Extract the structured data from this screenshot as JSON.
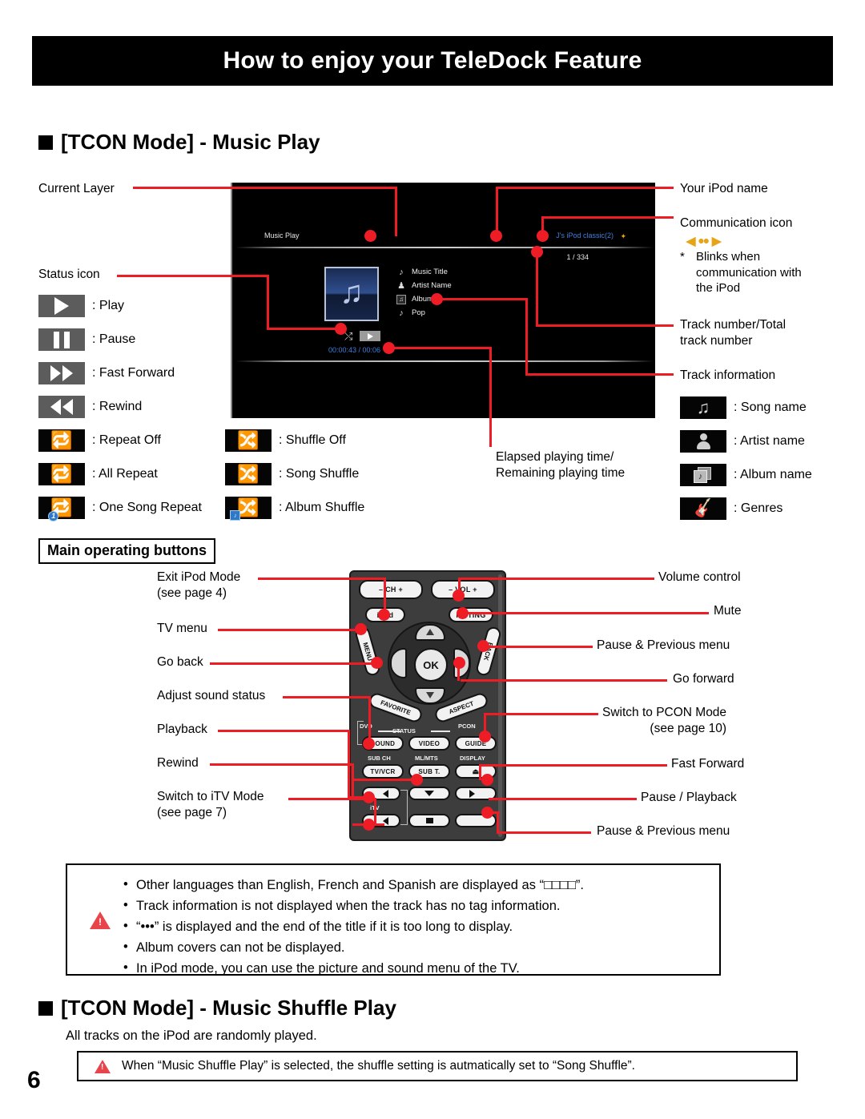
{
  "header": {
    "title": "How to enjoy your TeleDock Feature"
  },
  "sections": {
    "music_play": {
      "heading": "[TCON Mode] - Music Play"
    },
    "shuffle_play": {
      "heading": "[TCON Mode] - Music Shuffle Play",
      "description": "All tracks on the iPod are randomly played.",
      "warning": "When “Music Shuffle Play” is selected, the shuffle setting is autmatically set to “Song Shuffle”."
    }
  },
  "tv_screen": {
    "current_layer": "Music Play",
    "ipod_name": "J's iPod classic(2)",
    "comm_icon": "✦",
    "track_number": "1 / 334",
    "time": "00:00:43 / 00:06",
    "info_rows": [
      {
        "icon": "song-note-icon",
        "glyph": "♪",
        "text": "Music Title"
      },
      {
        "icon": "person-icon",
        "glyph": "♟",
        "text": "Artist Name"
      },
      {
        "icon": "album-icon",
        "glyph": "♫",
        "text": "Album"
      },
      {
        "icon": "guitar-icon",
        "glyph": "♪",
        "text": "Pop"
      }
    ],
    "shuffle_glyph": "⤭",
    "play_glyph": "▶"
  },
  "callouts_left": {
    "current_layer": "Current Layer",
    "status_icon": "Status icon"
  },
  "callouts_right": {
    "ipod_name": "Your iPod name",
    "comm_icon": "Communication icon",
    "comm_note": "Blinks when\ncommunication with\nthe iPod",
    "comm_star": "*",
    "track_number": "Track number/Total\ntrack number",
    "track_info": "Track information"
  },
  "callouts_center": {
    "elapsed": "Elapsed playing time/\nRemaining playing time"
  },
  "status_legend": [
    {
      "name": "play-icon",
      "label": ": Play",
      "style": "grey"
    },
    {
      "name": "pause-icon",
      "label": ": Pause",
      "style": "grey"
    },
    {
      "name": "fast-forward-icon",
      "label": ": Fast Forward",
      "style": "grey"
    },
    {
      "name": "rewind-icon",
      "label": ": Rewind",
      "style": "grey"
    },
    {
      "name": "repeat-off-icon",
      "label": ": Repeat Off",
      "style": "black"
    },
    {
      "name": "all-repeat-icon",
      "label": ": All Repeat",
      "style": "black"
    },
    {
      "name": "one-song-repeat-icon",
      "label": ": One Song Repeat",
      "style": "black"
    }
  ],
  "shuffle_legend": [
    {
      "name": "shuffle-off-icon",
      "label": ": Shuffle Off"
    },
    {
      "name": "song-shuffle-icon",
      "label": ": Song Shuffle"
    },
    {
      "name": "album-shuffle-icon",
      "label": ": Album Shuffle"
    }
  ],
  "track_info_legend": [
    {
      "name": "song-name-icon",
      "label": ": Song name"
    },
    {
      "name": "artist-name-icon",
      "label": ": Artist name"
    },
    {
      "name": "album-name-icon",
      "label": ": Album name"
    },
    {
      "name": "genres-icon",
      "label": ": Genres"
    }
  ],
  "main_buttons_title": "Main operating buttons",
  "remote_labels_left": [
    {
      "name": "exit-ipod-mode",
      "text": "Exit iPod Mode\n(see page 4)"
    },
    {
      "name": "tv-menu",
      "text": "TV menu"
    },
    {
      "name": "go-back",
      "text": "Go back"
    },
    {
      "name": "adjust-sound-status",
      "text": "Adjust sound status"
    },
    {
      "name": "playback",
      "text": "Playback"
    },
    {
      "name": "rewind",
      "text": "Rewind"
    },
    {
      "name": "switch-itv-mode",
      "text": "Switch to  iTV Mode\n(see page 7)"
    }
  ],
  "remote_labels_right": [
    {
      "name": "volume-control",
      "text": "Volume control"
    },
    {
      "name": "mute",
      "text": "Mute"
    },
    {
      "name": "pause-previous-menu-top",
      "text": "Pause & Previous menu"
    },
    {
      "name": "go-forward",
      "text": "Go  forward"
    },
    {
      "name": "switch-pcon-mode",
      "text": "Switch to PCON  Mode\n(see page 10)"
    },
    {
      "name": "fast-forward",
      "text": "Fast Forward"
    },
    {
      "name": "pause-playback",
      "text": "Pause / Playback"
    },
    {
      "name": "pause-previous-menu-bottom",
      "text": "Pause & Previous menu"
    }
  ],
  "remote": {
    "ch": "– CH +",
    "vol": "– VOL +",
    "ipod": "iPod",
    "muting": "MUTING",
    "menu": "MENU",
    "back": "BACK",
    "ok": "OK",
    "favorite": "FAVORITE",
    "aspect": "ASPECT",
    "dvd": "DVD",
    "status": "STATUS",
    "pcon": "PCON",
    "sound": "SOUND",
    "video": "VIDEO",
    "guide": "GUIDE",
    "sub_ch": "SUB CH",
    "ml_mts": "ML/MTS",
    "display": "DISPLAY",
    "tv_vcr": "TV/VCR",
    "sub_t": "SUB T.",
    "eject": "⏏",
    "itv": "iTV"
  },
  "notes": [
    "Other languages than English, French and Spanish are displayed as “□□□□”.",
    "Track information is not displayed when the track has no tag information.",
    "“•••” is displayed and the end of the title if it is too long to display.",
    "Album covers can not be displayed.",
    "In iPod mode, you can use the picture and sound menu of the TV."
  ],
  "page_number": "6",
  "colors": {
    "accent_red": "#ee1c25",
    "ipod_blue": "#3f7fe0",
    "comm_orange": "#e8a417"
  }
}
